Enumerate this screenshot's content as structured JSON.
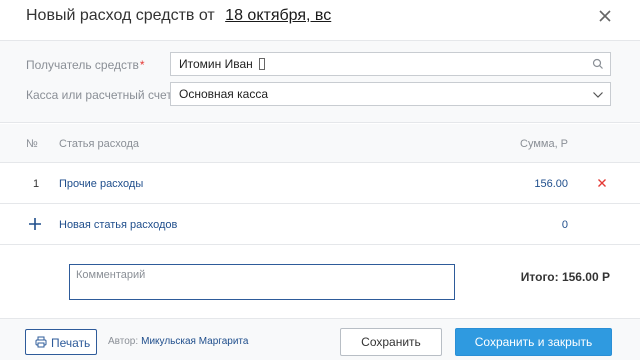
{
  "dialog": {
    "title": "Новый расход средств от",
    "date": "18 октября, вс"
  },
  "form": {
    "recipient": {
      "label": "Получатель средств",
      "value": "Итомин Иван"
    },
    "account": {
      "label": "Касса или расчетный счет",
      "value": "Основная касса"
    }
  },
  "table": {
    "headers": {
      "num": "№",
      "item": "Статья расхода",
      "sum": "Сумма, Р"
    },
    "rows": [
      {
        "num": "1",
        "item": "Прочие расходы",
        "sum": "156.00"
      }
    ],
    "new_row": {
      "label": "Новая статья расходов",
      "sum": "0"
    }
  },
  "comment": {
    "placeholder": "Комментарий"
  },
  "total": {
    "text": "Итого: 156.00 Р"
  },
  "footer": {
    "print_label": "Печать",
    "author_label": "Автор:",
    "author_name": "Микульская Маргарита",
    "save_label": "Сохранить",
    "save_close_label": "Сохранить и закрыть"
  },
  "icons": {
    "close": "close-icon",
    "search": "search-icon",
    "chevron": "chevron-down-icon",
    "delete": "delete-icon",
    "add": "plus-icon",
    "print": "printer-icon"
  },
  "colors": {
    "accent": "#2f9ae0",
    "link": "#1f4e8c",
    "danger": "#e53935"
  }
}
